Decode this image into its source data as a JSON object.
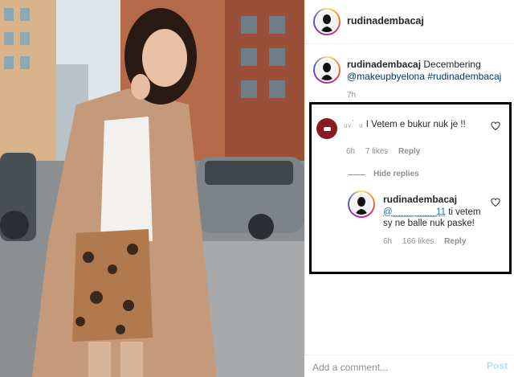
{
  "post": {
    "username": "rudinadembacaj",
    "caption_user": "rudinadembacaj",
    "caption_word": "Decembering",
    "mention_1": "@makeupbyelona",
    "hashtag_1": "#rudinadembacaj",
    "time": "7h"
  },
  "comments": [
    {
      "user": "ᵤᵥ˙ ᵤ",
      "text": "I Vetem e bukur nuk je !!",
      "time": "6h",
      "likes": "7 likes",
      "reply": "Reply"
    }
  ],
  "hide_replies": "Hide replies",
  "reply_comment": {
    "user": "rudinadembacaj",
    "mention": "@____ ____11",
    "text": "ti vetem sy ne balle nuk paske!",
    "time": "6h",
    "likes": "166 likes",
    "reply": "Reply"
  },
  "footer": {
    "placeholder": "Add a comment...",
    "post_label": "Post"
  },
  "colors": {
    "link": "#00376b",
    "post_button_disabled": "#b2dffc",
    "frame": "#000000"
  },
  "icons": [
    "heart-outline-icon",
    "avatar-story-ring"
  ]
}
